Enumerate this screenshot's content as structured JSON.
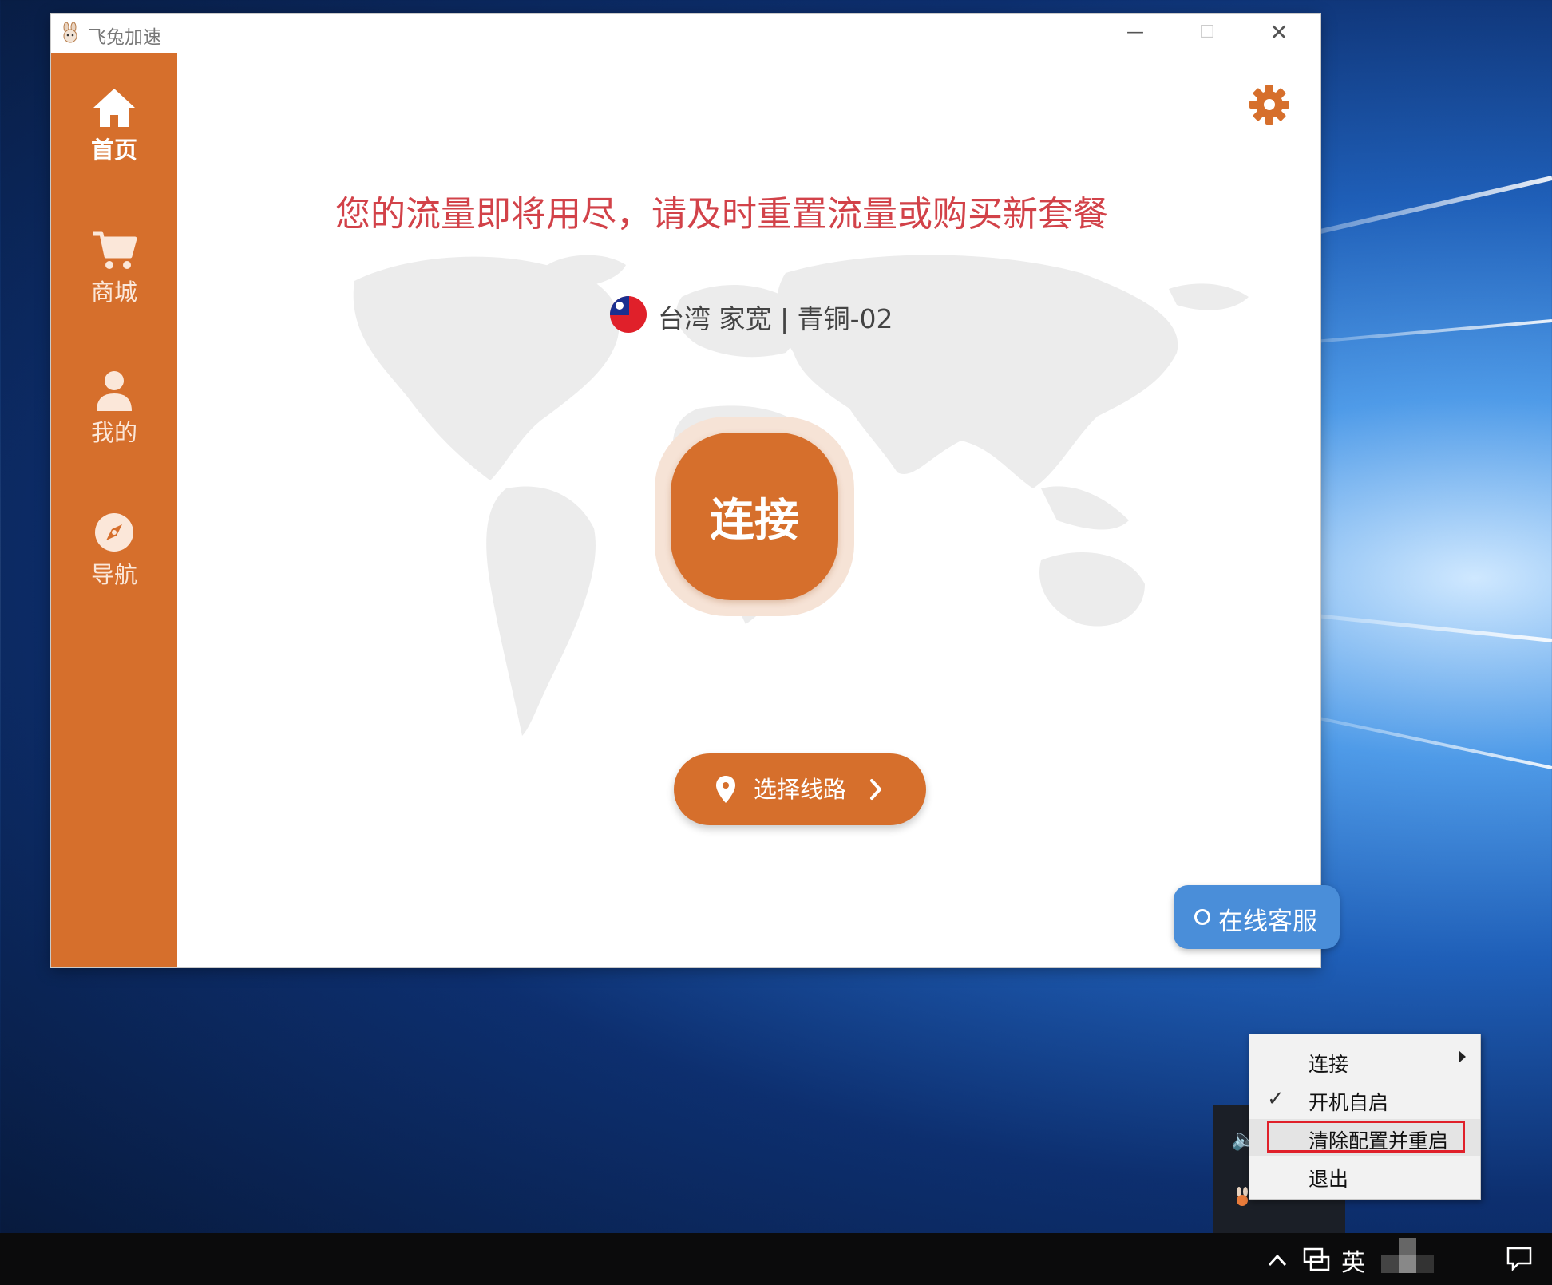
{
  "window": {
    "title": "飞兔加速",
    "controls": {
      "minimize": "—",
      "maximize": "☐",
      "close": "✕"
    }
  },
  "sidebar": {
    "items": [
      {
        "label": "首页",
        "icon": "home-icon",
        "active": true
      },
      {
        "label": "商城",
        "icon": "cart-icon",
        "active": false
      },
      {
        "label": "我的",
        "icon": "user-icon",
        "active": false
      },
      {
        "label": "导航",
        "icon": "compass-icon",
        "active": false
      }
    ]
  },
  "main": {
    "warning": "您的流量即将用尽，请及时重置流量或购买新套餐",
    "server": {
      "text": "台湾 家宽 | 青铜-02",
      "flag_icon": "taiwan-flag-icon"
    },
    "connect_label": "连接",
    "route_button": "选择线路",
    "service_button": "在线客服"
  },
  "context_menu": {
    "items": [
      {
        "label": "连接",
        "has_submenu": true,
        "checked": false
      },
      {
        "label": "开机自启",
        "has_submenu": false,
        "checked": true
      },
      {
        "label": "清除配置并重启",
        "has_submenu": false,
        "checked": false,
        "highlighted": true
      },
      {
        "label": "退出",
        "has_submenu": false,
        "checked": false
      }
    ],
    "check_mark": "✓"
  },
  "taskbar": {
    "chevron": "^",
    "ime": "英"
  },
  "colors": {
    "brand": "#d66f2c",
    "warning": "#d24249",
    "service": "#4a8ed9",
    "highlight_box": "#e0202a"
  }
}
